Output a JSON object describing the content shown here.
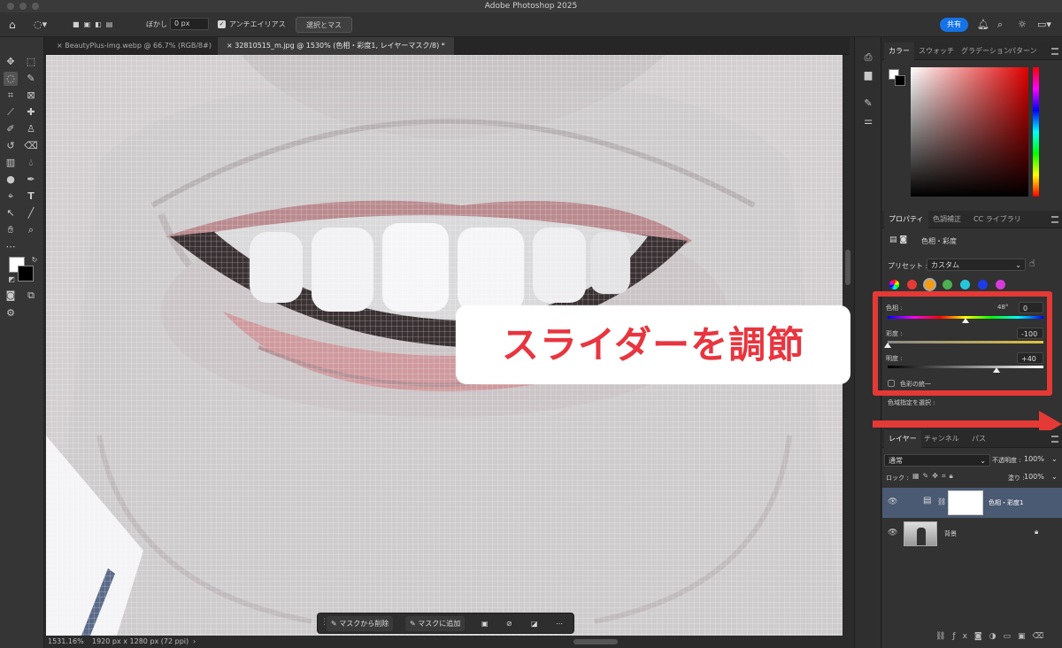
{
  "app": {
    "title": "Adobe Photoshop 2025"
  },
  "options_bar": {
    "feather_label": "ぼかし :",
    "feather_value": "0 px",
    "antialias_label": "アンチエイリアス",
    "select_mask_button": "選択とマスク...",
    "share_button": "共有"
  },
  "doc_tabs": [
    {
      "label": "BeautyPlus-img.webp @ 66.7% (RGB/8#)"
    },
    {
      "label": "32810515_m.jpg @ 1530% (色相・彩度1, レイヤーマスク/8) *"
    }
  ],
  "status": {
    "zoom": "1531.16%",
    "doc_size": "1920 px x 1280 px (72 ppi)"
  },
  "context_bar": {
    "remove_button": "マスクから削除",
    "add_button": "マスクに追加"
  },
  "callout": {
    "text": "スライダーを調節"
  },
  "color_panel": {
    "tabs": [
      "カラー",
      "スウォッチ",
      "グラデーション",
      "パターン"
    ],
    "active": "カラー"
  },
  "properties_panel": {
    "tabs": [
      "プロパティ",
      "色調補正",
      "CC ライブラリ"
    ],
    "title": "色相・彩度",
    "preset_label": "プリセット :",
    "preset_value": "カスタム",
    "swatch_colors": [
      "#e53935",
      "#f39c12",
      "#4caf50",
      "#26c6da",
      "#1e3ce6",
      "#d63bd9"
    ],
    "hue": {
      "label": "色相 :",
      "value": "0",
      "readout": "48°",
      "slider_fraction": 0.5
    },
    "saturation": {
      "label": "彩度 :",
      "value": "-100",
      "slider_fraction": 0.0
    },
    "lightness": {
      "label": "明度 :",
      "value": "+40",
      "slider_fraction": 0.7
    },
    "colorize_label": "色彩の統一",
    "range_label": "色域指定を選択 :"
  },
  "layers_panel": {
    "tabs": [
      "レイヤー",
      "チャンネル",
      "パス"
    ],
    "blend_mode": "通常",
    "opacity_label": "不透明度 :",
    "opacity_value": "100%",
    "lock_label": "ロック :",
    "fill_label": "塗り :",
    "fill_value": "100%",
    "layers": [
      {
        "name": "色相・彩度1"
      },
      {
        "name": "背景"
      }
    ]
  },
  "colors": {
    "accent": "#1473e6",
    "callout_red": "#e8353f",
    "highlight_red": "#e53935"
  }
}
